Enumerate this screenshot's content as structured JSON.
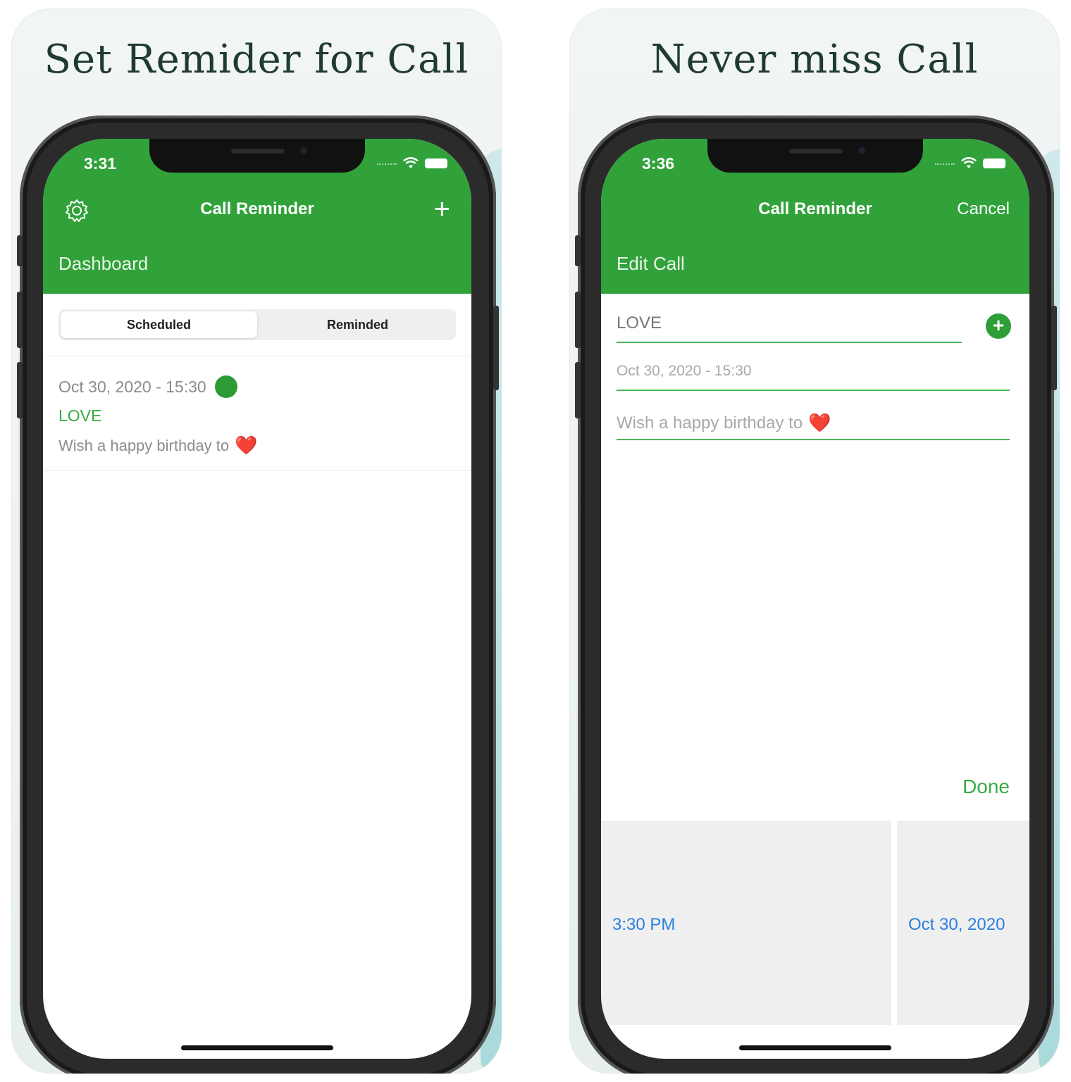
{
  "left": {
    "headline": "Set Remider for Call",
    "status_time": "3:31",
    "nav_title": "Call Reminder",
    "nav_right": "+",
    "large_title": "Dashboard",
    "tabs": [
      {
        "label": "Scheduled",
        "active": true
      },
      {
        "label": "Reminded",
        "active": false
      }
    ],
    "item": {
      "date": "Oct 30, 2020 - 15:30",
      "name": "LOVE",
      "message": "Wish a happy birthday to",
      "emoji": "❤️"
    }
  },
  "right": {
    "headline": "Never miss Call",
    "status_time": "3:36",
    "nav_title": "Call Reminder",
    "nav_right": "Cancel",
    "large_title": "Edit Call",
    "name_value": "LOVE",
    "date_value": "Oct 30, 2020 - 15:30",
    "message_value": "Wish a happy birthday to",
    "emoji": "❤️",
    "done_label": "Done",
    "time_pick": "3:30 PM",
    "date_pick": "Oct 30, 2020"
  },
  "colors": {
    "header_green": "#31a23a",
    "accent_green": "#3aaa44",
    "link_blue": "#2a7fe0"
  }
}
